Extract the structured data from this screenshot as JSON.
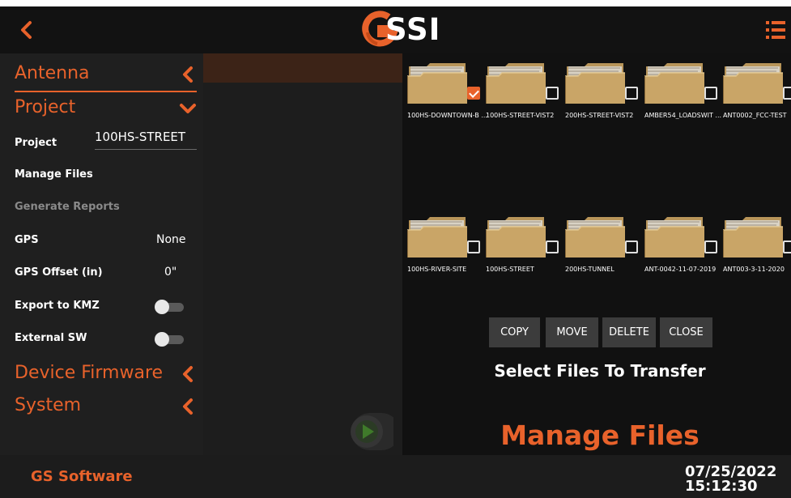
{
  "header": {
    "logo_text": "SSI",
    "brand_color": "#e8622b"
  },
  "sidebar": {
    "sections": {
      "antenna": "Antenna",
      "project": "Project",
      "device_firmware": "Device Firmware",
      "system": "System"
    },
    "project_rows": {
      "project_label": "Project",
      "project_value": "100HS-STREET",
      "manage_files": "Manage Files",
      "generate_reports": "Generate Reports",
      "gps_label": "GPS",
      "gps_value": "None",
      "gps_offset_label": "GPS Offset (in)",
      "gps_offset_value": "0\"",
      "export_kmz_label": "Export to KMZ",
      "export_kmz_on": false,
      "external_sw_label": "External SW",
      "external_sw_on": false
    }
  },
  "file_manager": {
    "files": [
      {
        "name": "100HS-DOWNTOWN-B ...",
        "checked": true
      },
      {
        "name": "100HS-STREET-VIST2",
        "checked": false
      },
      {
        "name": "200HS-STREET-VIST2",
        "checked": false
      },
      {
        "name": "AMBER54_LOADSWIT ...",
        "checked": false
      },
      {
        "name": "ANT0002_FCC-TEST",
        "checked": false
      },
      {
        "name": "100HS-RIVER-SITE",
        "checked": false
      },
      {
        "name": "100HS-STREET",
        "checked": false
      },
      {
        "name": "200HS-TUNNEL",
        "checked": false
      },
      {
        "name": "ANT-0042-11-07-2019",
        "checked": false
      },
      {
        "name": "ANT003-3-11-2020",
        "checked": false
      }
    ],
    "buttons": {
      "copy": "COPY",
      "move": "MOVE",
      "delete": "DELETE",
      "close": "CLOSE"
    },
    "instruction": "Select Files To Transfer",
    "title": "Manage Files"
  },
  "footer": {
    "app_name": "GS Software",
    "date": "07/25/2022",
    "time": "15:12:30"
  }
}
